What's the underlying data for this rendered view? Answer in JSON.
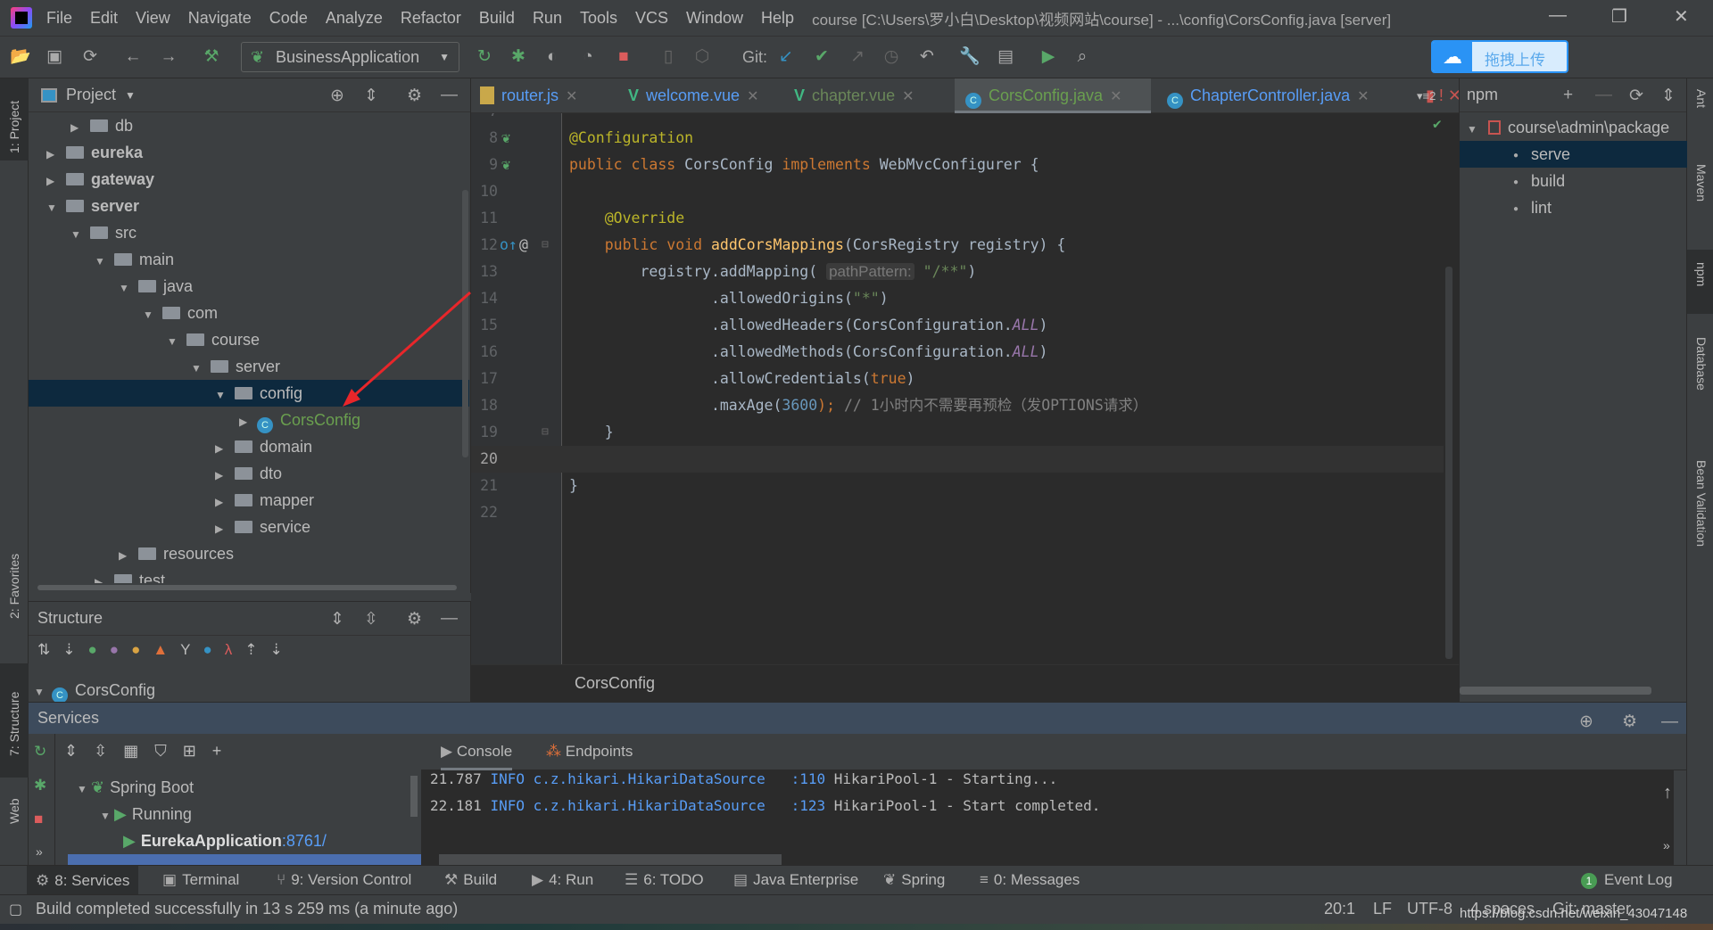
{
  "window": {
    "title": "course [C:\\Users\\罗小白\\Desktop\\视频网站\\course] - ...\\config\\CorsConfig.java [server]"
  },
  "menu": [
    "File",
    "Edit",
    "View",
    "Navigate",
    "Code",
    "Analyze",
    "Refactor",
    "Build",
    "Run",
    "Tools",
    "VCS",
    "Window",
    "Help"
  ],
  "toolbar": {
    "run_config": "BusinessApplication",
    "git_label": "Git:",
    "upload_label": "拖拽上传"
  },
  "left_stripe": [
    "1: Project",
    "2: Favorites",
    "7: Structure",
    "Web"
  ],
  "right_stripe": [
    "Ant",
    "Maven",
    "npm",
    "Database",
    "Bean Validation"
  ],
  "project": {
    "title": "Project",
    "tree": [
      {
        "label": "db",
        "level": 1,
        "expanded": false,
        "bold": false
      },
      {
        "label": "eureka",
        "level": 0,
        "expanded": false,
        "bold": true
      },
      {
        "label": "gateway",
        "level": 0,
        "expanded": false,
        "bold": true
      },
      {
        "label": "server",
        "level": 0,
        "expanded": true,
        "bold": true
      },
      {
        "label": "src",
        "level": 1,
        "expanded": true
      },
      {
        "label": "main",
        "level": 2,
        "expanded": true
      },
      {
        "label": "java",
        "level": 3,
        "expanded": true
      },
      {
        "label": "com",
        "level": 4,
        "expanded": true
      },
      {
        "label": "course",
        "level": 5,
        "expanded": true
      },
      {
        "label": "server",
        "level": 6,
        "expanded": true
      },
      {
        "label": "config",
        "level": 7,
        "expanded": true,
        "selected": true
      },
      {
        "label": "CorsConfig",
        "level": 8,
        "expanded": false,
        "class": true
      },
      {
        "label": "domain",
        "level": 7,
        "expanded": false
      },
      {
        "label": "dto",
        "level": 7,
        "expanded": false
      },
      {
        "label": "mapper",
        "level": 7,
        "expanded": false
      },
      {
        "label": "service",
        "level": 7,
        "expanded": false
      },
      {
        "label": "resources",
        "level": 3,
        "expanded": false
      },
      {
        "label": "test",
        "level": 2,
        "expanded": false
      }
    ]
  },
  "structure": {
    "title": "Structure",
    "root": "CorsConfig"
  },
  "editor": {
    "tabs": [
      {
        "label": "router.js",
        "icon": "js",
        "color": "#589df6"
      },
      {
        "label": "welcome.vue",
        "icon": "vue",
        "color": "#589df6"
      },
      {
        "label": "chapter.vue",
        "icon": "vue",
        "color": "#6a8759"
      },
      {
        "label": "CorsConfig.java",
        "icon": "class",
        "color": "#6a9f4f",
        "active": true
      },
      {
        "label": "ChapterController.java",
        "icon": "class",
        "color": "#589df6"
      }
    ],
    "tab_overflow": "2",
    "current_line": 20,
    "lines": [
      {
        "n": 7,
        "seg": []
      },
      {
        "n": 8,
        "seg": [
          [
            "@Configuration",
            "an"
          ]
        ]
      },
      {
        "n": 9,
        "seg": [
          [
            "public class ",
            "kw"
          ],
          [
            "CorsConfig ",
            ""
          ],
          [
            "implements ",
            "kw"
          ],
          [
            "WebMvcConfigurer {",
            ""
          ]
        ]
      },
      {
        "n": 10,
        "seg": []
      },
      {
        "n": 11,
        "seg": [
          [
            "    ",
            ""
          ],
          [
            "@Override",
            "an"
          ]
        ]
      },
      {
        "n": 12,
        "seg": [
          [
            "    ",
            ""
          ],
          [
            "public void ",
            "kw"
          ],
          [
            "addCorsMappings",
            "fn"
          ],
          [
            "(CorsRegistry registry) {",
            ""
          ]
        ]
      },
      {
        "n": 13,
        "seg": [
          [
            "        registry.addMapping( ",
            ""
          ],
          [
            "pathPattern:",
            "hint"
          ],
          [
            " ",
            ""
          ],
          [
            "\"/**\"",
            "st"
          ],
          [
            ")",
            ""
          ]
        ]
      },
      {
        "n": 14,
        "seg": [
          [
            "                .allowedOrigins(",
            ""
          ],
          [
            "\"*\"",
            "st"
          ],
          [
            ")",
            ""
          ]
        ]
      },
      {
        "n": 15,
        "seg": [
          [
            "                .allowedHeaders(CorsConfiguration.",
            ""
          ],
          [
            "ALL",
            "co"
          ],
          [
            ")",
            ""
          ]
        ]
      },
      {
        "n": 16,
        "seg": [
          [
            "                .allowedMethods(CorsConfiguration.",
            ""
          ],
          [
            "ALL",
            "co"
          ],
          [
            ")",
            ""
          ]
        ]
      },
      {
        "n": 17,
        "seg": [
          [
            "                .allowCredentials(",
            ""
          ],
          [
            "true",
            "kw"
          ],
          [
            ")",
            ""
          ]
        ]
      },
      {
        "n": 18,
        "seg": [
          [
            "                .maxAge(",
            ""
          ],
          [
            "3600",
            "nu"
          ],
          [
            ");",
            "kw"
          ],
          [
            " // 1小时内不需要再预检（发OPTIONS请求）",
            "cm"
          ]
        ]
      },
      {
        "n": 19,
        "seg": [
          [
            "    }",
            ""
          ]
        ]
      },
      {
        "n": 20,
        "seg": []
      },
      {
        "n": 21,
        "seg": [
          [
            "}",
            ""
          ]
        ]
      },
      {
        "n": 22,
        "seg": []
      }
    ],
    "breadcrumb": "CorsConfig"
  },
  "npm": {
    "title": "npm",
    "root": "course\\admin\\package",
    "scripts": [
      "serve",
      "build",
      "lint"
    ],
    "selected": "serve"
  },
  "services": {
    "title": "Services",
    "tabs": [
      "Console",
      "Endpoints"
    ],
    "tree": [
      {
        "label": "Spring Boot",
        "level": 0
      },
      {
        "label": "Running",
        "level": 1
      },
      {
        "label": "EurekaApplication",
        "port": ":8761/",
        "level": 2
      }
    ],
    "console": [
      {
        "time": "21.787",
        "level": "INFO",
        "logger": "c.z.hikari.HikariDataSource",
        "line": ":110",
        "msg": "HikariPool-1 - Starting..."
      },
      {
        "time": "22.181",
        "level": "INFO",
        "logger": "c.z.hikari.HikariDataSource",
        "line": ":123",
        "msg": "HikariPool-1 - Start completed."
      }
    ]
  },
  "bottom_tools": [
    "8: Services",
    "Terminal",
    "9: Version Control",
    "Build",
    "4: Run",
    "6: TODO",
    "Java Enterprise",
    "Spring",
    "0: Messages"
  ],
  "event_log": {
    "label": "Event Log",
    "count": "1"
  },
  "status": {
    "message": "Build completed successfully in 13 s 259 ms (a minute ago)",
    "position": "20:1",
    "line_sep": "LF",
    "encoding": "UTF-8",
    "indent": "4 spaces",
    "git": "Git: master",
    "watermark": "https://blog.csdn.net/weixin_43047148"
  },
  "colors": {
    "editor_bg": "#2b2b2b",
    "panel_bg": "#3c3f41",
    "selection": "#0d293e",
    "annotation_arrow": "#e8262a"
  }
}
